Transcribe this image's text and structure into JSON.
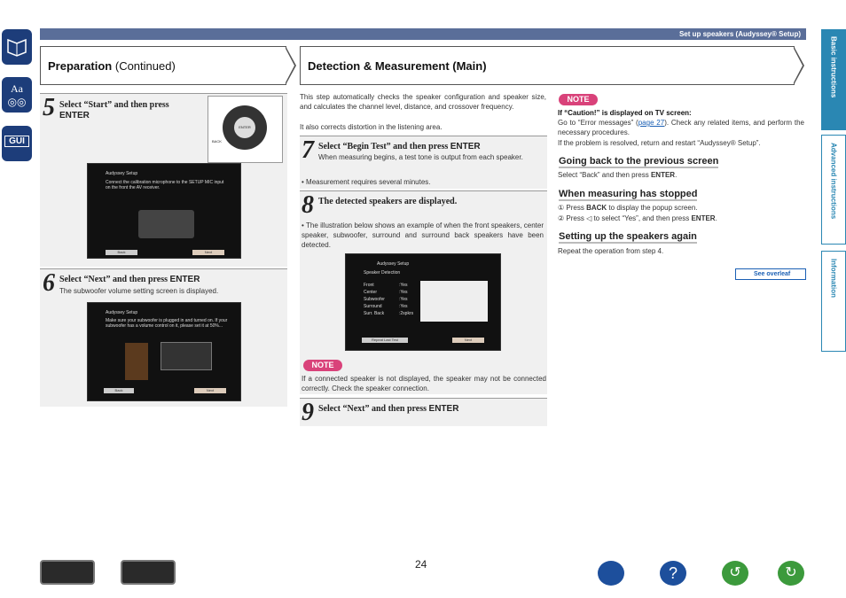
{
  "topbar": {
    "label": "Set up speakers (Audyssey® Setup)"
  },
  "left_header": {
    "title_bold": "Preparation",
    "title_normal": " (Continued)"
  },
  "right_header": {
    "title": "Detection & Measurement (Main)"
  },
  "side_tabs": [
    "Basic instructions",
    "Advanced instructions",
    "Information"
  ],
  "step5": {
    "num": "5",
    "text": "Select “Start” and then press",
    "key": "ENTER",
    "screen_title": "Audyssey Setup",
    "screen_text": "Connect the calibration microphone to the SETUP MIC input on the front the AV receiver.",
    "back": "Back",
    "next": "Next",
    "remote_label": "ENTER",
    "back_label": "BACK"
  },
  "step6": {
    "num": "6",
    "text": "Select “Next” and then press",
    "key": "ENTER",
    "desc": "The subwoofer volume setting screen is displayed.",
    "screen_title": "Audyssey Setup",
    "screen_text": "Make sure your subwoofer is plugged in and turned on. If your subwoofer has a volume control on it, please set it at 50%...",
    "back": "Back",
    "next": "Next"
  },
  "intro": "This step automatically checks the speaker configuration and speaker size, and calculates the channel level, distance, and crossover frequency.",
  "intro2": "It also corrects distortion in the listening area.",
  "step7": {
    "num": "7",
    "text": "Select “Begin Test” and then press",
    "key": "ENTER",
    "desc": "When measuring begins, a test tone is output from each speaker.",
    "bullet": "• Measurement requires several minutes."
  },
  "step8": {
    "num": "8",
    "text": "The detected speakers are displayed.",
    "bullet": "• The illustration below shows an example of when the front speakers, center speaker, subwoofer, surround and surround back speakers have been detected.",
    "screen": {
      "title": "Audyssey Setup",
      "subtitle": "Speaker Detection",
      "rows": [
        [
          "Front",
          ":Yes"
        ],
        [
          "Center",
          ":Yes"
        ],
        [
          "Subwoofer",
          ":Yes"
        ],
        [
          "Surround",
          ":Yes"
        ],
        [
          "Surr. Back",
          ":2spkrs"
        ]
      ],
      "retry": "Repeat Last Test",
      "next": "Next"
    }
  },
  "note1": {
    "badge": "NOTE",
    "text": "If a connected speaker is not displayed, the speaker may not be connected correctly. Check the speaker connection."
  },
  "step9": {
    "num": "9",
    "text": "Select “Next” and then press",
    "key": "ENTER"
  },
  "note2": {
    "badge": "NOTE",
    "caution_title": "If “Caution!” is displayed on TV screen:",
    "caution_text1": "Go to “Error messages” (",
    "caution_link": "page 27",
    "caution_text2": "). Check any related items, and perform the necessary procedures.",
    "caution_text3": "If the problem is resolved, return and restart “Audyssey® Setup”."
  },
  "going_back": {
    "title": "Going back to the previous screen",
    "text": "Select “Back” and then press",
    "key": "ENTER"
  },
  "stopped": {
    "title": "When measuring has stopped",
    "line1a": "① Press",
    "line1key": "BACK",
    "line1b": "to display the popup screen.",
    "line2a": "② Press ◁ to select “Yes”, and then press",
    "line2key": "ENTER"
  },
  "again": {
    "title": "Setting up the speakers again",
    "text": "Repeat the operation from step 4."
  },
  "see_overleaf": "See overleaf",
  "page_number": "24"
}
